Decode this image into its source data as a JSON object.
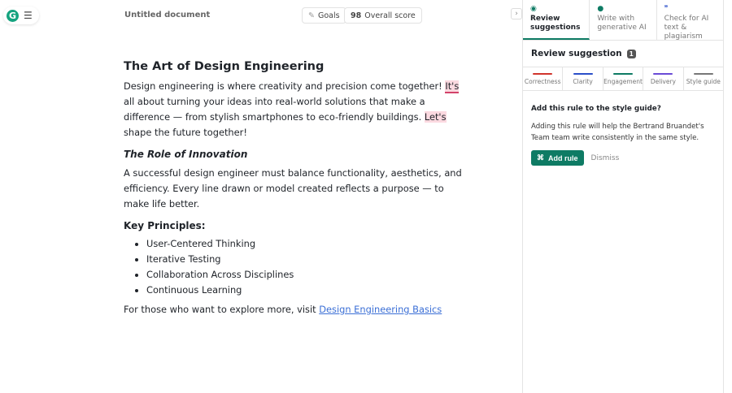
{
  "header": {
    "doc_title": "Untitled document",
    "goals_label": "Goals",
    "score_value": "98",
    "score_label": "Overall score"
  },
  "editor": {
    "title": "The Art of Design Engineering",
    "p1": {
      "l1a": "Design engineering is where creativity and precision come together! ",
      "l1b": "It's",
      "l2": "all about turning your ideas into real-world solutions that make a",
      "l3a": "difference — from stylish smartphones to eco-friendly buildings. ",
      "l3b": "Let's",
      "l4": "shape the future together!"
    },
    "h2": "The Role of Innovation",
    "p2": [
      "A successful design engineer must balance functionality, aesthetics, and",
      "efficiency. Every line drawn or model created reflects a purpose — to",
      "make life better."
    ],
    "h3": "Key Principles:",
    "list": [
      "User-Centered Thinking",
      "Iterative Testing",
      "Collaboration Across Disciplines",
      "Continuous Learning"
    ],
    "p3": "For those who want to explore more, visit ",
    "link": "Design Engineering Basics"
  },
  "panel": {
    "tabs": [
      {
        "l1": "Review",
        "l2": "suggestions"
      },
      {
        "l1": "Write with",
        "l2": "generative AI"
      },
      {
        "l1": "Check for AI",
        "l2": "text & plagiarism"
      }
    ],
    "review_title": "Review suggestion",
    "count": "1",
    "categories": [
      {
        "label": "Correctness",
        "color": "#d0342c"
      },
      {
        "label": "Clarity",
        "color": "#2a4fc9"
      },
      {
        "label": "Engagement",
        "color": "#0e7b64"
      },
      {
        "label": "Delivery",
        "color": "#6a4bd6"
      },
      {
        "label": "Style guide",
        "color": "#777777"
      }
    ],
    "card": {
      "title": "Add this rule to the style guide?",
      "body": "Adding this rule will help the Bertrand Bruandet's Team team write consistently in the same style.",
      "add": "Add rule",
      "dismiss": "Dismiss"
    }
  }
}
